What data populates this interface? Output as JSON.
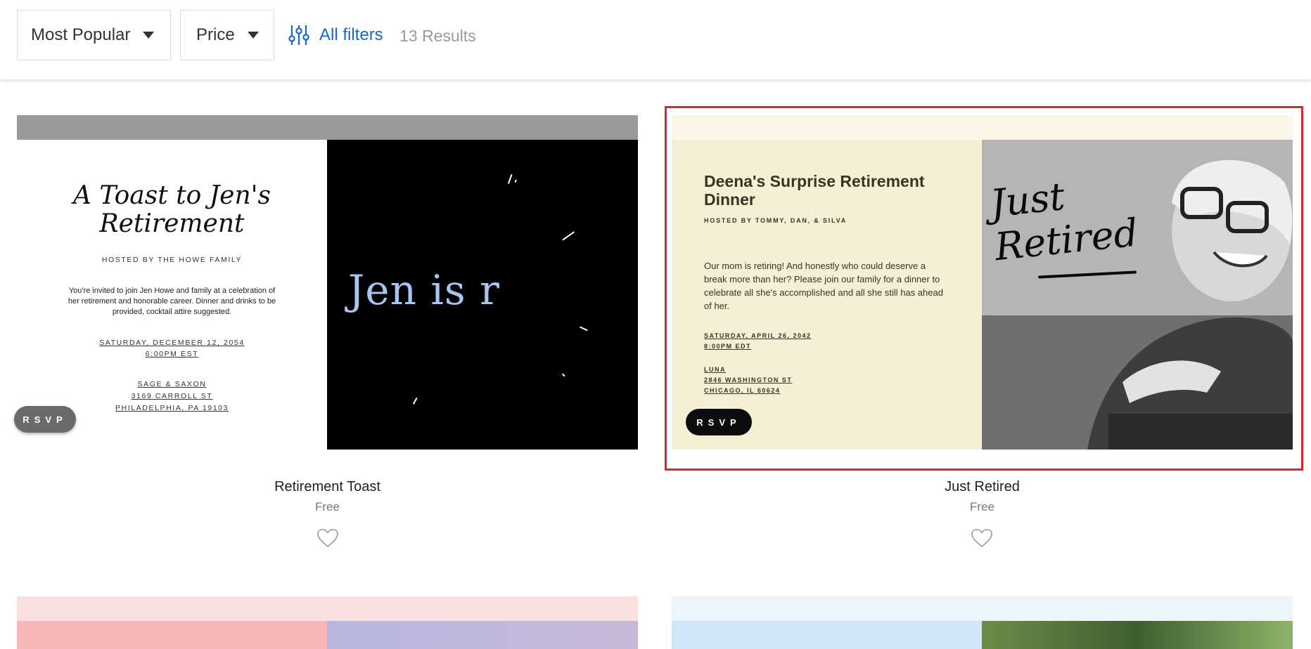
{
  "toolbar": {
    "sort_label": "Most Popular",
    "price_label": "Price",
    "filters_label": "All filters",
    "results_text": "13 Results",
    "accent_color": "#1a66c9"
  },
  "cards": [
    {
      "name": "Retirement Toast",
      "price": "Free",
      "invite": {
        "title_line1": "A Toast to Jen's",
        "title_line2": "Retirement",
        "hosted": "HOSTED BY THE HOWE FAMILY",
        "body": "You're invited to join Jen Howe and family at a celebration of her retirement and honorable career. Dinner and drinks to be provided, cocktail attire suggested.",
        "date": "SATURDAY, DECEMBER 12, 2054",
        "time": "6:00PM EST",
        "venue": "SAGE & SAXON",
        "address": "3169 CARROLL ST",
        "city": "PHILADELPHIA, PA 19103",
        "rsvp": "RSVP",
        "animated_text": "Jen is r"
      }
    },
    {
      "name": "Just Retired",
      "price": "Free",
      "selected": true,
      "invite": {
        "title": "Deena's Surprise Retirement Dinner",
        "hosted": "HOSTED BY TOMMY, DAN, & SILVA",
        "body": "Our mom is retiring! And honestly who could deserve a break more than her? Please join our family for a dinner to celebrate all she's accomplished and all she still has ahead of her.",
        "date": "SATURDAY, APRIL 26, 2042",
        "time": "8:00PM EDT",
        "venue": "LUNA",
        "address": "2846 WASHINGTON ST",
        "city": "CHICAGO, IL 60624",
        "rsvp": "RSVP",
        "overlay_line1": "Just",
        "overlay_line2": "Retired"
      }
    }
  ],
  "icons": {
    "filters": "sliders-icon",
    "caret": "caret-down-icon",
    "favorite": "heart-outline-icon"
  },
  "colors": {
    "selection_border": "#e0262a"
  }
}
